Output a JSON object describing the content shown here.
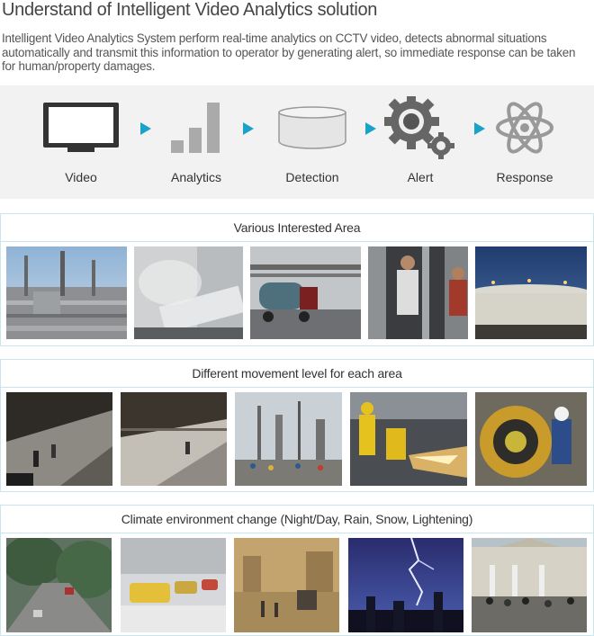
{
  "title": "Understand of Intelligent Video Analytics solution",
  "intro": "Intelligent Video Analytics System perform real-time analytics on CCTV video, detects abnormal situations automatically and transmit this information to operator by generating alert, so immediate response can be taken for human/property damages.",
  "flow": {
    "steps": [
      {
        "label": "Video",
        "icon": "monitor-icon"
      },
      {
        "label": "Analytics",
        "icon": "bar-chart-icon"
      },
      {
        "label": "Detection",
        "icon": "database-icon"
      },
      {
        "label": "Alert",
        "icon": "gears-icon"
      },
      {
        "label": "Response",
        "icon": "atom-icon"
      }
    ],
    "arrow_color": "#1aa3c8"
  },
  "sections": [
    {
      "heading": "Various Interested Area",
      "photos": [
        "refinery plant",
        "pipe in steam",
        "tanker truck at facility",
        "people at gates",
        "storage tanks at dusk"
      ]
    },
    {
      "heading": "Different movement level for each area",
      "photos": [
        "street sidewalk at night",
        "sidewalk with pedestrian",
        "industrial site with workers",
        "worker cutting with sparks",
        "worker at machinery"
      ]
    },
    {
      "heading": "Climate environment change (Night/Day, Rain, Snow, Lightening)",
      "photos": [
        "rainy street",
        "taxi in snow",
        "sandstorm street",
        "lightning over city",
        "crowd near building"
      ]
    }
  ]
}
